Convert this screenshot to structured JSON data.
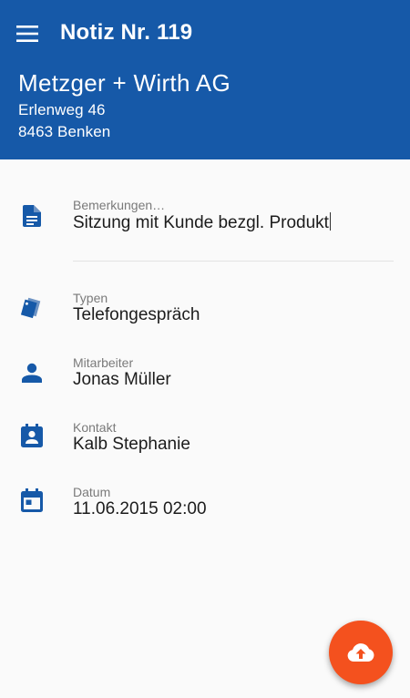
{
  "app_bar": {
    "title": "Notiz Nr. 119",
    "menu_icon": "hamburger-menu-icon"
  },
  "customer": {
    "name": "Metzger + Wirth AG",
    "street": "Erlenweg 46",
    "city": "8463 Benken"
  },
  "fields": {
    "remarks": {
      "label": "Bemerkungen…",
      "value": "Sitzung mit Kunde bezgl. Produkt",
      "icon": "document-icon"
    },
    "type": {
      "label": "Typen",
      "value": "Telefongespräch",
      "icon": "tags-icon"
    },
    "employee": {
      "label": "Mitarbeiter",
      "value": "Jonas Müller",
      "icon": "person-icon"
    },
    "contact": {
      "label": "Kontakt",
      "value": "Kalb Stephanie",
      "icon": "contact-card-icon"
    },
    "date": {
      "label": "Datum",
      "value": "11.06.2015 02:00",
      "icon": "calendar-icon"
    }
  },
  "fab": {
    "icon": "cloud-upload-icon"
  },
  "colors": {
    "primary": "#1659a8",
    "accent": "#f4511e",
    "icon": "#1659a8",
    "background": "#fafafa"
  }
}
